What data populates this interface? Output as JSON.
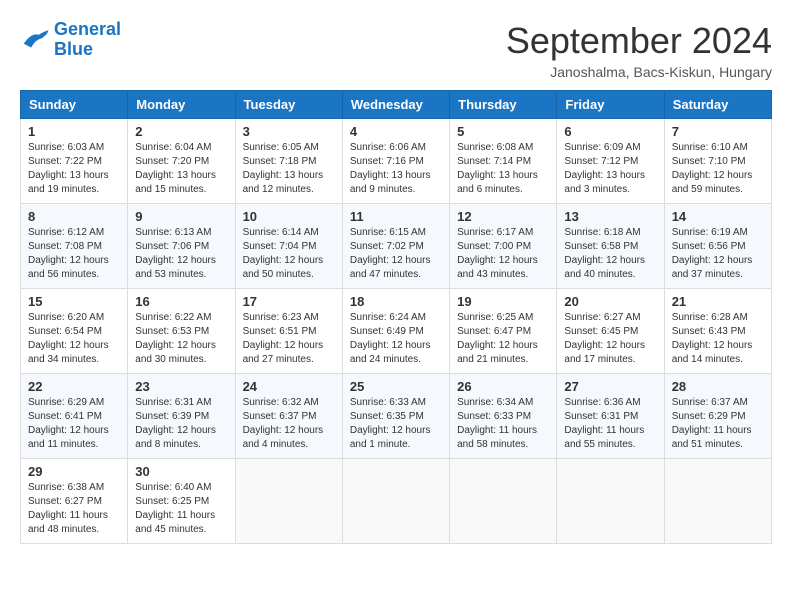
{
  "header": {
    "logo_line1": "General",
    "logo_line2": "Blue",
    "month": "September 2024",
    "location": "Janoshalma, Bacs-Kiskun, Hungary"
  },
  "weekdays": [
    "Sunday",
    "Monday",
    "Tuesday",
    "Wednesday",
    "Thursday",
    "Friday",
    "Saturday"
  ],
  "weeks": [
    [
      {
        "day": 1,
        "info": "Sunrise: 6:03 AM\nSunset: 7:22 PM\nDaylight: 13 hours\nand 19 minutes."
      },
      {
        "day": 2,
        "info": "Sunrise: 6:04 AM\nSunset: 7:20 PM\nDaylight: 13 hours\nand 15 minutes."
      },
      {
        "day": 3,
        "info": "Sunrise: 6:05 AM\nSunset: 7:18 PM\nDaylight: 13 hours\nand 12 minutes."
      },
      {
        "day": 4,
        "info": "Sunrise: 6:06 AM\nSunset: 7:16 PM\nDaylight: 13 hours\nand 9 minutes."
      },
      {
        "day": 5,
        "info": "Sunrise: 6:08 AM\nSunset: 7:14 PM\nDaylight: 13 hours\nand 6 minutes."
      },
      {
        "day": 6,
        "info": "Sunrise: 6:09 AM\nSunset: 7:12 PM\nDaylight: 13 hours\nand 3 minutes."
      },
      {
        "day": 7,
        "info": "Sunrise: 6:10 AM\nSunset: 7:10 PM\nDaylight: 12 hours\nand 59 minutes."
      }
    ],
    [
      {
        "day": 8,
        "info": "Sunrise: 6:12 AM\nSunset: 7:08 PM\nDaylight: 12 hours\nand 56 minutes."
      },
      {
        "day": 9,
        "info": "Sunrise: 6:13 AM\nSunset: 7:06 PM\nDaylight: 12 hours\nand 53 minutes."
      },
      {
        "day": 10,
        "info": "Sunrise: 6:14 AM\nSunset: 7:04 PM\nDaylight: 12 hours\nand 50 minutes."
      },
      {
        "day": 11,
        "info": "Sunrise: 6:15 AM\nSunset: 7:02 PM\nDaylight: 12 hours\nand 47 minutes."
      },
      {
        "day": 12,
        "info": "Sunrise: 6:17 AM\nSunset: 7:00 PM\nDaylight: 12 hours\nand 43 minutes."
      },
      {
        "day": 13,
        "info": "Sunrise: 6:18 AM\nSunset: 6:58 PM\nDaylight: 12 hours\nand 40 minutes."
      },
      {
        "day": 14,
        "info": "Sunrise: 6:19 AM\nSunset: 6:56 PM\nDaylight: 12 hours\nand 37 minutes."
      }
    ],
    [
      {
        "day": 15,
        "info": "Sunrise: 6:20 AM\nSunset: 6:54 PM\nDaylight: 12 hours\nand 34 minutes."
      },
      {
        "day": 16,
        "info": "Sunrise: 6:22 AM\nSunset: 6:53 PM\nDaylight: 12 hours\nand 30 minutes."
      },
      {
        "day": 17,
        "info": "Sunrise: 6:23 AM\nSunset: 6:51 PM\nDaylight: 12 hours\nand 27 minutes."
      },
      {
        "day": 18,
        "info": "Sunrise: 6:24 AM\nSunset: 6:49 PM\nDaylight: 12 hours\nand 24 minutes."
      },
      {
        "day": 19,
        "info": "Sunrise: 6:25 AM\nSunset: 6:47 PM\nDaylight: 12 hours\nand 21 minutes."
      },
      {
        "day": 20,
        "info": "Sunrise: 6:27 AM\nSunset: 6:45 PM\nDaylight: 12 hours\nand 17 minutes."
      },
      {
        "day": 21,
        "info": "Sunrise: 6:28 AM\nSunset: 6:43 PM\nDaylight: 12 hours\nand 14 minutes."
      }
    ],
    [
      {
        "day": 22,
        "info": "Sunrise: 6:29 AM\nSunset: 6:41 PM\nDaylight: 12 hours\nand 11 minutes."
      },
      {
        "day": 23,
        "info": "Sunrise: 6:31 AM\nSunset: 6:39 PM\nDaylight: 12 hours\nand 8 minutes."
      },
      {
        "day": 24,
        "info": "Sunrise: 6:32 AM\nSunset: 6:37 PM\nDaylight: 12 hours\nand 4 minutes."
      },
      {
        "day": 25,
        "info": "Sunrise: 6:33 AM\nSunset: 6:35 PM\nDaylight: 12 hours\nand 1 minute."
      },
      {
        "day": 26,
        "info": "Sunrise: 6:34 AM\nSunset: 6:33 PM\nDaylight: 11 hours\nand 58 minutes."
      },
      {
        "day": 27,
        "info": "Sunrise: 6:36 AM\nSunset: 6:31 PM\nDaylight: 11 hours\nand 55 minutes."
      },
      {
        "day": 28,
        "info": "Sunrise: 6:37 AM\nSunset: 6:29 PM\nDaylight: 11 hours\nand 51 minutes."
      }
    ],
    [
      {
        "day": 29,
        "info": "Sunrise: 6:38 AM\nSunset: 6:27 PM\nDaylight: 11 hours\nand 48 minutes."
      },
      {
        "day": 30,
        "info": "Sunrise: 6:40 AM\nSunset: 6:25 PM\nDaylight: 11 hours\nand 45 minutes."
      },
      null,
      null,
      null,
      null,
      null
    ]
  ]
}
